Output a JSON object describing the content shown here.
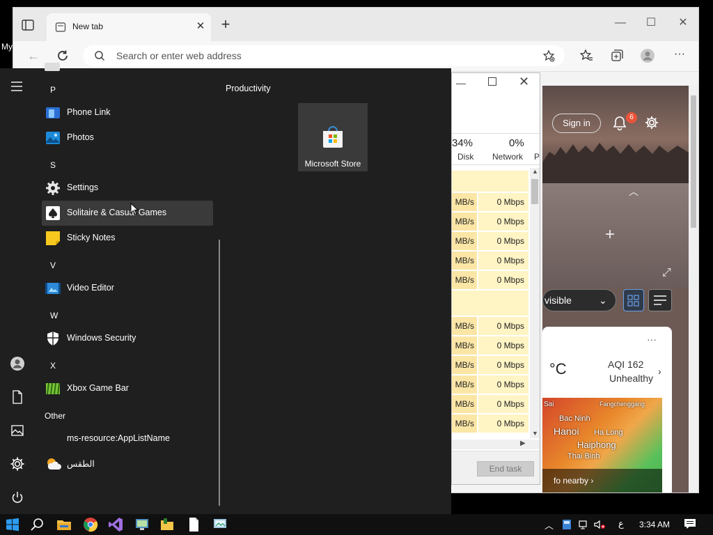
{
  "desktop": {
    "partial_label": "My"
  },
  "browser": {
    "tab_title": "New tab",
    "tab_close": "✕",
    "new_tab": "+",
    "minimize": "—",
    "maximize": "☐",
    "close": "✕",
    "back": "←",
    "address_placeholder": "Search or enter web address",
    "page": {
      "sign_in": "Sign in",
      "notification_count": "6",
      "layout_dropdown": "visible",
      "weather": {
        "temp_unit": "°C",
        "aqi": "AQI 162",
        "aqi_status": "Unhealthy",
        "more": "···",
        "map_labels": [
          "Fangchenggang",
          "Bac Ninh",
          "Hanoi",
          "Ha Long",
          "Haiphong",
          "Thai Binh"
        ],
        "map_partial": "Sai",
        "nearby": "fo nearby"
      }
    }
  },
  "task_manager": {
    "close": "✕",
    "minimize": "—",
    "disk_pct": "34%",
    "disk_label": "Disk",
    "network_pct": "0%",
    "network_label": "Network",
    "p_label": "P",
    "group1_rows": [
      {
        "disk": "MB/s",
        "network": "0 Mbps"
      },
      {
        "disk": "MB/s",
        "network": "0 Mbps"
      },
      {
        "disk": "MB/s",
        "network": "0 Mbps"
      },
      {
        "disk": "MB/s",
        "network": "0 Mbps"
      },
      {
        "disk": "MB/s",
        "network": "0 Mbps"
      }
    ],
    "group2_rows": [
      {
        "disk": "MB/s",
        "network": "0 Mbps"
      },
      {
        "disk": "MB/s",
        "network": "0 Mbps"
      },
      {
        "disk": "MB/s",
        "network": "0 Mbps"
      },
      {
        "disk": "MB/s",
        "network": "0 Mbps"
      },
      {
        "disk": "MB/s",
        "network": "0 Mbps"
      },
      {
        "disk": "MB/s",
        "network": "0 Mbps"
      }
    ],
    "end_task": "End task"
  },
  "start_menu": {
    "letters": {
      "p": "P",
      "s": "S",
      "v": "V",
      "w": "W",
      "x": "X",
      "other": "Other"
    },
    "apps": {
      "phone_link": "Phone Link",
      "photos": "Photos",
      "settings": "Settings",
      "solitaire": "Solitaire & Casual Games",
      "sticky_notes": "Sticky Notes",
      "video_editor": "Video Editor",
      "windows_security": "Windows Security",
      "xbox_game_bar": "Xbox Game Bar",
      "ms_resource": "ms-resource:AppListName",
      "weather_arabic": "الطقس"
    },
    "group_title": "Productivity",
    "tile_store": "Microsoft Store"
  },
  "taskbar": {
    "lang": "ع",
    "clock": "3:34 AM"
  },
  "colors": {
    "accent": "#0078d4",
    "start_bg": "#1f1f1f",
    "taskbar_bg": "#101010"
  }
}
